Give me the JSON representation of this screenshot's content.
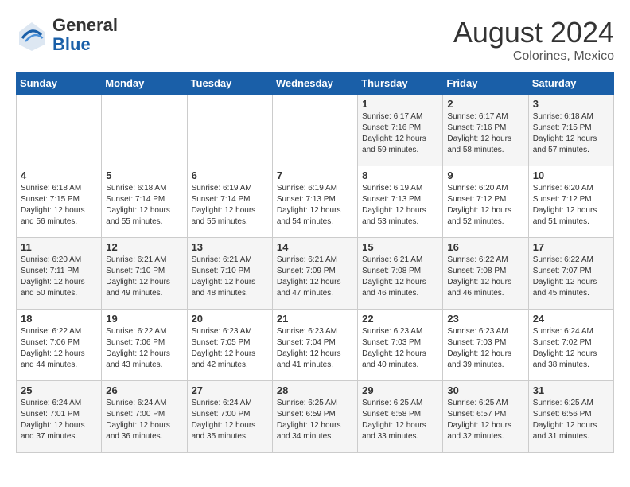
{
  "header": {
    "logo_general": "General",
    "logo_blue": "Blue",
    "month_year": "August 2024",
    "location": "Colorines, Mexico"
  },
  "weekdays": [
    "Sunday",
    "Monday",
    "Tuesday",
    "Wednesday",
    "Thursday",
    "Friday",
    "Saturday"
  ],
  "weeks": [
    [
      {
        "day": "",
        "info": ""
      },
      {
        "day": "",
        "info": ""
      },
      {
        "day": "",
        "info": ""
      },
      {
        "day": "",
        "info": ""
      },
      {
        "day": "1",
        "info": "Sunrise: 6:17 AM\nSunset: 7:16 PM\nDaylight: 12 hours\nand 59 minutes."
      },
      {
        "day": "2",
        "info": "Sunrise: 6:17 AM\nSunset: 7:16 PM\nDaylight: 12 hours\nand 58 minutes."
      },
      {
        "day": "3",
        "info": "Sunrise: 6:18 AM\nSunset: 7:15 PM\nDaylight: 12 hours\nand 57 minutes."
      }
    ],
    [
      {
        "day": "4",
        "info": "Sunrise: 6:18 AM\nSunset: 7:15 PM\nDaylight: 12 hours\nand 56 minutes."
      },
      {
        "day": "5",
        "info": "Sunrise: 6:18 AM\nSunset: 7:14 PM\nDaylight: 12 hours\nand 55 minutes."
      },
      {
        "day": "6",
        "info": "Sunrise: 6:19 AM\nSunset: 7:14 PM\nDaylight: 12 hours\nand 55 minutes."
      },
      {
        "day": "7",
        "info": "Sunrise: 6:19 AM\nSunset: 7:13 PM\nDaylight: 12 hours\nand 54 minutes."
      },
      {
        "day": "8",
        "info": "Sunrise: 6:19 AM\nSunset: 7:13 PM\nDaylight: 12 hours\nand 53 minutes."
      },
      {
        "day": "9",
        "info": "Sunrise: 6:20 AM\nSunset: 7:12 PM\nDaylight: 12 hours\nand 52 minutes."
      },
      {
        "day": "10",
        "info": "Sunrise: 6:20 AM\nSunset: 7:12 PM\nDaylight: 12 hours\nand 51 minutes."
      }
    ],
    [
      {
        "day": "11",
        "info": "Sunrise: 6:20 AM\nSunset: 7:11 PM\nDaylight: 12 hours\nand 50 minutes."
      },
      {
        "day": "12",
        "info": "Sunrise: 6:21 AM\nSunset: 7:10 PM\nDaylight: 12 hours\nand 49 minutes."
      },
      {
        "day": "13",
        "info": "Sunrise: 6:21 AM\nSunset: 7:10 PM\nDaylight: 12 hours\nand 48 minutes."
      },
      {
        "day": "14",
        "info": "Sunrise: 6:21 AM\nSunset: 7:09 PM\nDaylight: 12 hours\nand 47 minutes."
      },
      {
        "day": "15",
        "info": "Sunrise: 6:21 AM\nSunset: 7:08 PM\nDaylight: 12 hours\nand 46 minutes."
      },
      {
        "day": "16",
        "info": "Sunrise: 6:22 AM\nSunset: 7:08 PM\nDaylight: 12 hours\nand 46 minutes."
      },
      {
        "day": "17",
        "info": "Sunrise: 6:22 AM\nSunset: 7:07 PM\nDaylight: 12 hours\nand 45 minutes."
      }
    ],
    [
      {
        "day": "18",
        "info": "Sunrise: 6:22 AM\nSunset: 7:06 PM\nDaylight: 12 hours\nand 44 minutes."
      },
      {
        "day": "19",
        "info": "Sunrise: 6:22 AM\nSunset: 7:06 PM\nDaylight: 12 hours\nand 43 minutes."
      },
      {
        "day": "20",
        "info": "Sunrise: 6:23 AM\nSunset: 7:05 PM\nDaylight: 12 hours\nand 42 minutes."
      },
      {
        "day": "21",
        "info": "Sunrise: 6:23 AM\nSunset: 7:04 PM\nDaylight: 12 hours\nand 41 minutes."
      },
      {
        "day": "22",
        "info": "Sunrise: 6:23 AM\nSunset: 7:03 PM\nDaylight: 12 hours\nand 40 minutes."
      },
      {
        "day": "23",
        "info": "Sunrise: 6:23 AM\nSunset: 7:03 PM\nDaylight: 12 hours\nand 39 minutes."
      },
      {
        "day": "24",
        "info": "Sunrise: 6:24 AM\nSunset: 7:02 PM\nDaylight: 12 hours\nand 38 minutes."
      }
    ],
    [
      {
        "day": "25",
        "info": "Sunrise: 6:24 AM\nSunset: 7:01 PM\nDaylight: 12 hours\nand 37 minutes."
      },
      {
        "day": "26",
        "info": "Sunrise: 6:24 AM\nSunset: 7:00 PM\nDaylight: 12 hours\nand 36 minutes."
      },
      {
        "day": "27",
        "info": "Sunrise: 6:24 AM\nSunset: 7:00 PM\nDaylight: 12 hours\nand 35 minutes."
      },
      {
        "day": "28",
        "info": "Sunrise: 6:25 AM\nSunset: 6:59 PM\nDaylight: 12 hours\nand 34 minutes."
      },
      {
        "day": "29",
        "info": "Sunrise: 6:25 AM\nSunset: 6:58 PM\nDaylight: 12 hours\nand 33 minutes."
      },
      {
        "day": "30",
        "info": "Sunrise: 6:25 AM\nSunset: 6:57 PM\nDaylight: 12 hours\nand 32 minutes."
      },
      {
        "day": "31",
        "info": "Sunrise: 6:25 AM\nSunset: 6:56 PM\nDaylight: 12 hours\nand 31 minutes."
      }
    ]
  ]
}
